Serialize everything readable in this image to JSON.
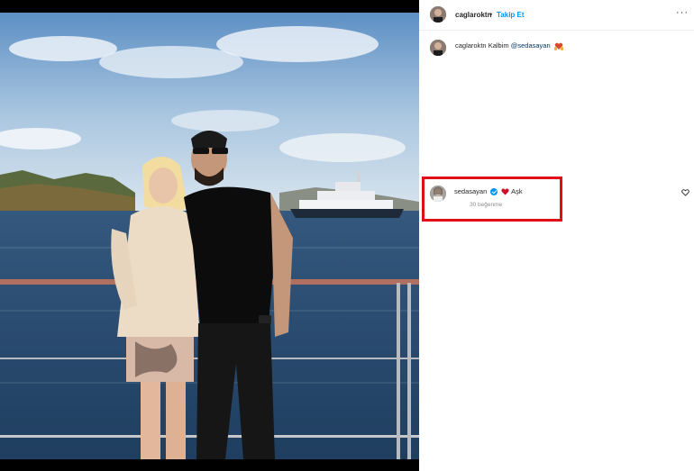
{
  "post": {
    "author": "caglaroktn",
    "separator": "•",
    "follow_label": "Takip Et",
    "more_label": "···"
  },
  "caption": {
    "user": "caglaroktn",
    "text": "Kalbim",
    "mention": "@sedasayan"
  },
  "comment": {
    "user": "sedasayan",
    "text": "Aşk",
    "likes": "30 beğenme"
  },
  "colors": {
    "highlight": "#e20e17",
    "link": "#0095f6",
    "mention": "#00376b"
  }
}
